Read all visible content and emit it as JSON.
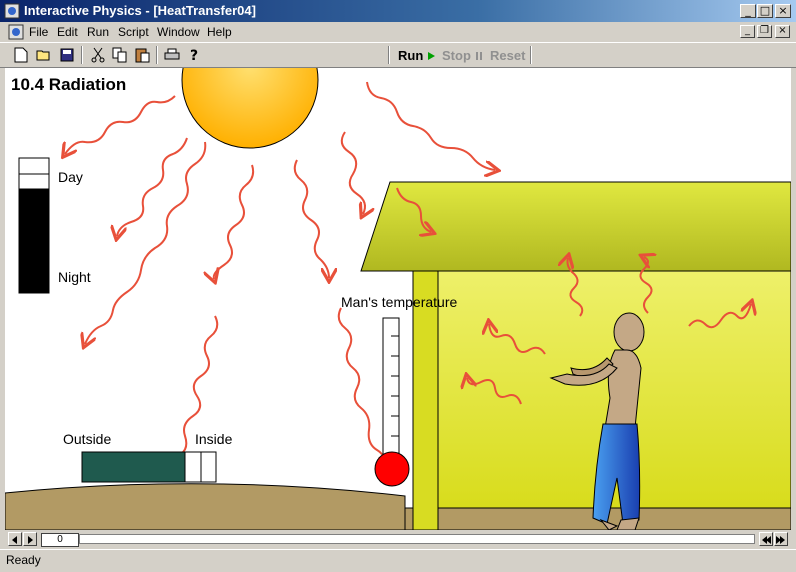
{
  "window": {
    "title": "Interactive Physics - [HeatTransfer04]"
  },
  "menu": {
    "items": [
      "File",
      "Edit",
      "Run",
      "Script",
      "Window",
      "Help"
    ]
  },
  "toolbar": {
    "run_label": "Run",
    "stop_label": "Stop",
    "reset_label": "Reset"
  },
  "scene": {
    "heading": "10.4 Radiation",
    "day_label": "Day",
    "night_label": "Night",
    "outside_label": "Outside",
    "inside_label": "Inside",
    "temperature_label": "Man's temperature"
  },
  "frame_counter": {
    "value": "0"
  },
  "status": {
    "text": "Ready"
  },
  "colors": {
    "sun": "#ffc000",
    "ray": "#e8503a",
    "ground": "#b29a64",
    "wall": "#e6e83c",
    "roof": "#c8d02c",
    "slider": "#1f5a4e",
    "thermo_bulb": "#ff0000",
    "pants": "#2f5fcf"
  },
  "sliders": {
    "day_night_level": 0.8,
    "outside_inside_level": 0.8
  }
}
